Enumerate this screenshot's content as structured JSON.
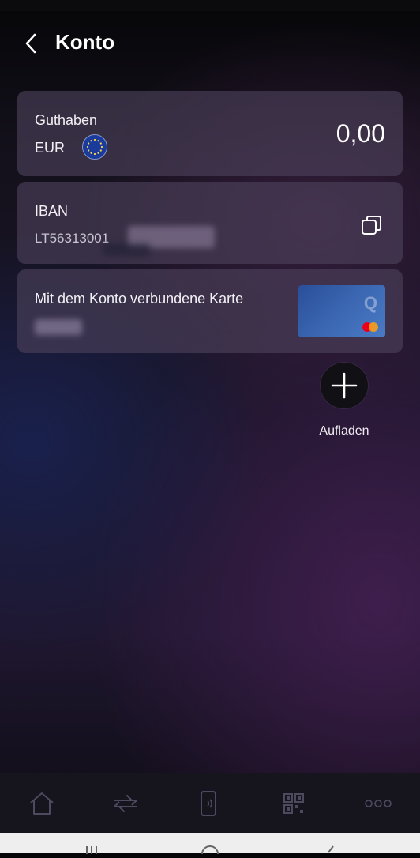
{
  "header": {
    "title": "Konto"
  },
  "balance_card": {
    "label": "Guthaben",
    "currency": "EUR",
    "amount": "0,00"
  },
  "iban_card": {
    "label": "IBAN",
    "iban_visible": "LT56313001"
  },
  "linked_card": {
    "label": "Mit dem Konto verbundene Karte",
    "card_letter": "Q"
  },
  "topup": {
    "label": "Aufladen"
  },
  "bottom_nav": {
    "items": [
      "home-icon",
      "transfer-icon",
      "phone-pay-icon",
      "qr-code-icon",
      "more-icon"
    ]
  },
  "colors": {
    "accent": "#2a4f9a",
    "card_bg": "#4e425c",
    "background": "#1a1528"
  }
}
